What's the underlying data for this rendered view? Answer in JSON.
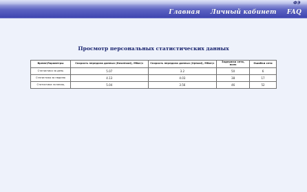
{
  "header": {
    "logo_text": "ФЭ",
    "nav": [
      {
        "label": "Главная"
      },
      {
        "label": "Личный кабинет"
      },
      {
        "label": "FAQ"
      }
    ]
  },
  "main": {
    "title": "Просмотр персональных статистических данных",
    "table": {
      "columns": [
        "Время\\Параметры",
        "Скорость передачи данных (Download), Мбит/с",
        "Скорость передачи данных (Upload), Мбит/с",
        "Задержка сети, мсек",
        "Ошибки сети"
      ],
      "rows": [
        [
          "Статистика за день",
          "5.07",
          "3.2",
          "50",
          "6"
        ],
        [
          "Статистика за неделю",
          "4.13",
          "4.03",
          "38",
          "17"
        ],
        [
          "Статистика за месяц",
          "5.04",
          "3.56",
          "46",
          "52"
        ]
      ]
    }
  }
}
